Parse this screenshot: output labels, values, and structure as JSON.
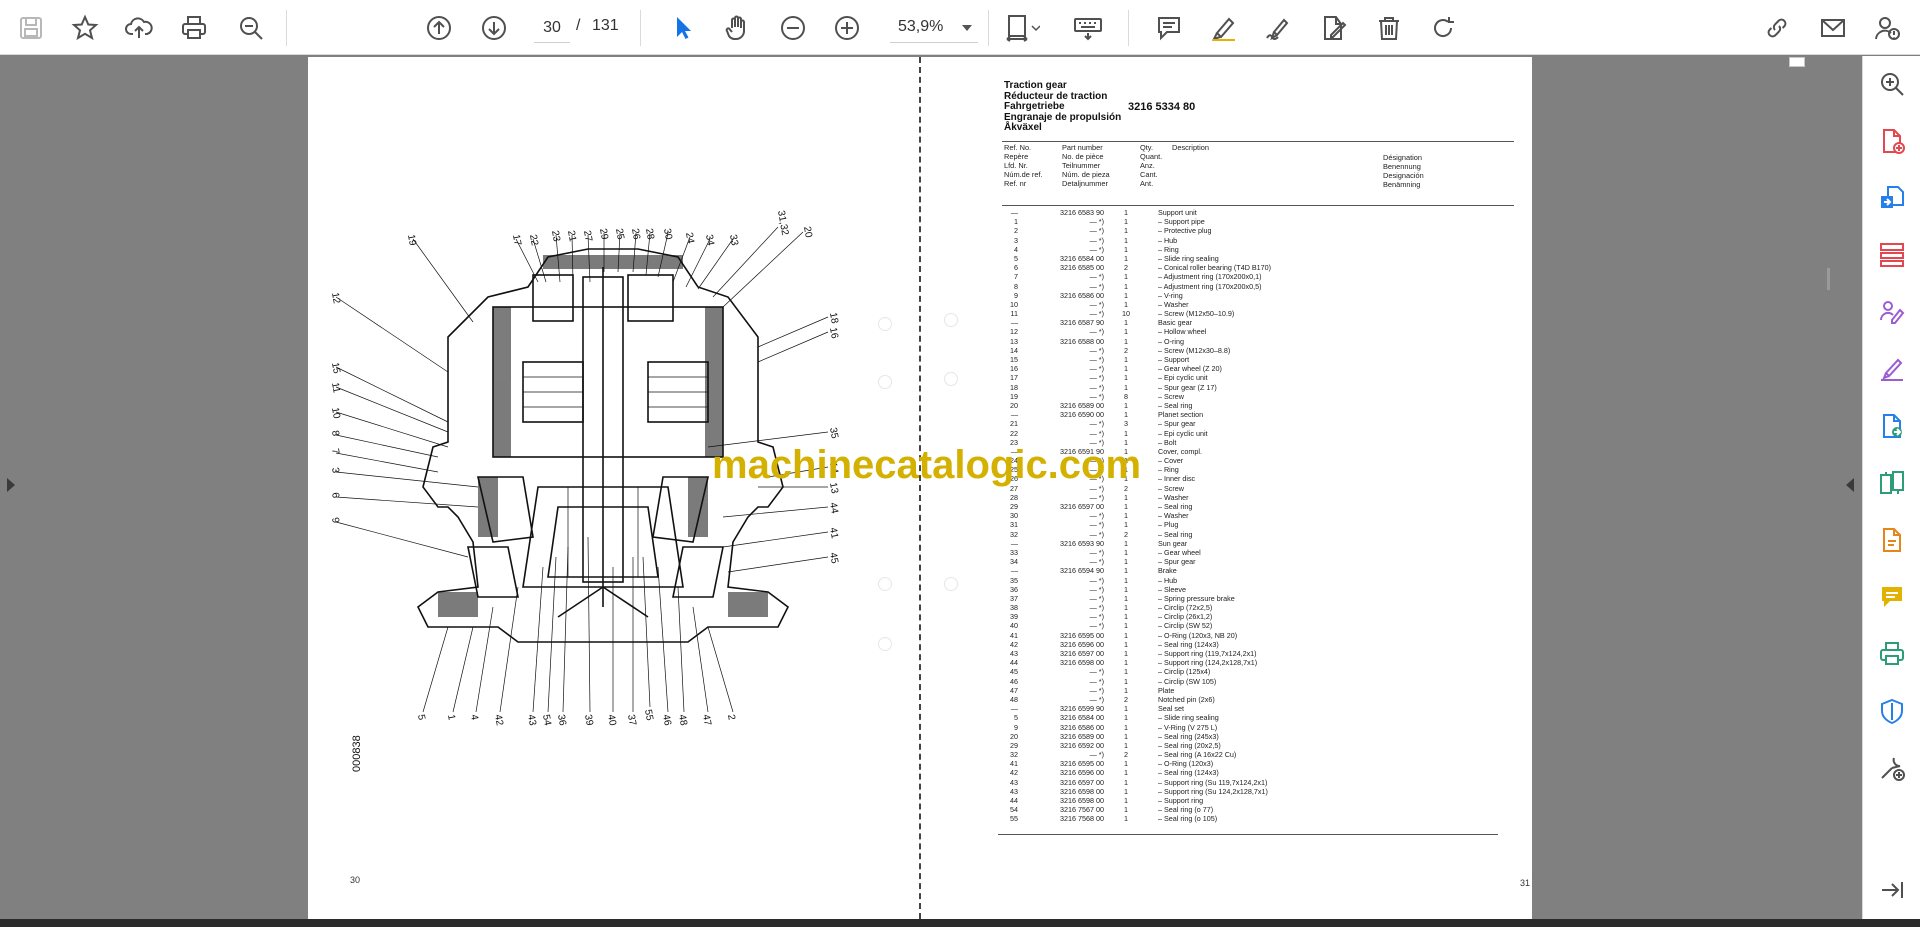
{
  "toolbar": {
    "save_icon": "save-icon",
    "bookmark_icon": "star-icon",
    "upload_icon": "upload-cloud-icon",
    "print_icon": "printer-icon",
    "find_icon": "search-icon",
    "prev_page_icon": "arrow-up-circle-icon",
    "next_page_icon": "arrow-down-circle-icon",
    "current_page": "30",
    "page_separator": "/",
    "total_pages": "131",
    "select_tool_icon": "cursor-arrow-icon",
    "hand_tool_icon": "hand-icon",
    "zoom_out_icon": "minus-circle-icon",
    "zoom_in_icon": "plus-circle-icon",
    "zoom_level": "53,9%",
    "fit_page_icon": "fit-page-icon",
    "keyboard_icon": "keyboard-icon",
    "comment_icon": "comment-icon",
    "highlight_icon": "highlighter-icon",
    "sign_icon": "pen-sign-icon",
    "edit_icon": "edit-document-icon",
    "delete_icon": "trash-icon",
    "rotate_icon": "rotate-icon",
    "share_link_icon": "share-link-icon",
    "email_icon": "envelope-icon",
    "account_icon": "account-icon",
    "accent_color": "#1473e6"
  },
  "rightbar": {
    "items": [
      "zoom-search-icon",
      "create-pdf-icon",
      "export-pdf-icon",
      "organize-pages-icon",
      "request-signature-icon",
      "fill-sign-icon",
      "convert-pdf-icon",
      "compare-icon",
      "edit-pdf-icon",
      "comment-sidebar-icon",
      "print-production-icon",
      "protect-shield-icon",
      "more-tools-icon",
      "expand-panel-icon"
    ],
    "colors": {
      "red": "#e34850",
      "blue": "#2680eb",
      "purple": "#9c5dd4",
      "orange": "#e68619",
      "yellow": "#e1b200",
      "green": "#2d9d78",
      "gray": "#505050"
    }
  },
  "left_page": {
    "page_number": "30",
    "drawing_id": "000838",
    "callouts_top": [
      "19",
      "17",
      "22",
      "23",
      "21",
      "27",
      "29",
      "25",
      "26",
      "28",
      "30",
      "24",
      "34",
      "33",
      "31,32",
      "20"
    ],
    "callouts_left": [
      "12",
      "15",
      "11",
      "10",
      "8",
      "7",
      "3",
      "6",
      "9"
    ],
    "callouts_right": [
      "18",
      "16",
      "35",
      "14",
      "13",
      "44",
      "41",
      "45"
    ],
    "callouts_bottom": [
      "5",
      "1",
      "4",
      "42",
      "43",
      "54",
      "36",
      "39",
      "40",
      "37",
      "55",
      "46",
      "48",
      "47",
      "2"
    ]
  },
  "right_page": {
    "page_number": "31",
    "titles": [
      "Traction gear",
      "Réducteur de traction",
      "Fahrgetriebe",
      "Engranaje de propulsión",
      "Åkväxel"
    ],
    "catalog_number": "3216 5334 80",
    "col_ref": [
      "Ref. No.",
      "Repère",
      "Lfd. Nr.",
      "Núm.de ref.",
      "Ref. nr"
    ],
    "col_part": [
      "Part number",
      "No. de pièce",
      "Teilnummer",
      "Núm. de pieza",
      "Detaljnummer"
    ],
    "col_qty": [
      "Qty.",
      "Quant.",
      "Anz.",
      "Cant.",
      "Ant."
    ],
    "col_desc": [
      "Description"
    ],
    "col_desc_lang": [
      "Désignation",
      "Benennung",
      "Designación",
      "Benämning"
    ],
    "rows": [
      [
        "—",
        "3216 6583 90",
        "1",
        "Support unit"
      ],
      [
        "1",
        "—      *)",
        "1",
        "– Support pipe"
      ],
      [
        "2",
        "—      *)",
        "1",
        "– Protective plug"
      ],
      [
        "3",
        "—      *)",
        "1",
        "– Hub"
      ],
      [
        "4",
        "—      *)",
        "1",
        "– Ring"
      ],
      [
        "5",
        "3216 6584 00",
        "1",
        "– Slide ring sealing"
      ],
      [
        "6",
        "3216 6585 00",
        "2",
        "– Conical roller bearing (T4D B170)"
      ],
      [
        "7",
        "—      *)",
        "1",
        "– Adjustment ring (170x200x0,1)"
      ],
      [
        "8",
        "—      *)",
        "1",
        "– Adjustment ring (170x200x0,5)"
      ],
      [
        "9",
        "3216 6586 00",
        "1",
        "– V-ring"
      ],
      [
        "10",
        "—      *)",
        "1",
        "– Washer"
      ],
      [
        "11",
        "—      *)",
        "10",
        "– Screw (M12x50–10.9)"
      ],
      [
        "—",
        "3216 6587 90",
        "1",
        "Basic gear"
      ],
      [
        "12",
        "—      *)",
        "1",
        "– Hollow wheel"
      ],
      [
        "13",
        "3216 6588 00",
        "1",
        "– O-ring"
      ],
      [
        "14",
        "—      *)",
        "2",
        "– Screw (M12x30–8.8)"
      ],
      [
        "15",
        "—      *)",
        "1",
        "– Support"
      ],
      [
        "16",
        "—      *)",
        "1",
        "– Gear wheel (Z 20)"
      ],
      [
        "17",
        "—      *)",
        "1",
        "– Epi cyclic unit"
      ],
      [
        "18",
        "—      *)",
        "1",
        "– Spur gear (Z 17)"
      ],
      [
        "19",
        "—      *)",
        "8",
        "– Screw"
      ],
      [
        "20",
        "3216 6589 00",
        "1",
        "– Seal ring"
      ],
      [
        "—",
        "3216 6590 00",
        "1",
        "Planet section"
      ],
      [
        "21",
        "—      *)",
        "3",
        "– Spur gear"
      ],
      [
        "22",
        "—      *)",
        "1",
        "– Epi cyclic unit"
      ],
      [
        "23",
        "—      *)",
        "1",
        "– Bolt"
      ],
      [
        "—",
        "3216 6591 90",
        "1",
        "Cover, compl."
      ],
      [
        "24",
        "—      *)",
        "1",
        "– Cover"
      ],
      [
        "25",
        "—      *)",
        "1",
        "– Ring"
      ],
      [
        "26",
        "—      *)",
        "1",
        "– Inner disc"
      ],
      [
        "27",
        "—      *)",
        "2",
        "– Screw"
      ],
      [
        "28",
        "—      *)",
        "1",
        "– Washer"
      ],
      [
        "29",
        "3216 6597 00",
        "1",
        "– Seal ring"
      ],
      [
        "30",
        "—      *)",
        "1",
        "– Washer"
      ],
      [
        "31",
        "—      *)",
        "1",
        "– Plug"
      ],
      [
        "32",
        "—      *)",
        "2",
        "– Seal ring"
      ],
      [
        "—",
        "3216 6593 90",
        "1",
        "Sun gear"
      ],
      [
        "33",
        "—      *)",
        "1",
        "– Gear wheel"
      ],
      [
        "34",
        "—      *)",
        "1",
        "– Spur gear"
      ],
      [
        "—",
        "3216 6594 90",
        "1",
        "Brake"
      ],
      [
        "35",
        "—      *)",
        "1",
        "– Hub"
      ],
      [
        "36",
        "—      *)",
        "1",
        "– Sleeve"
      ],
      [
        "37",
        "—      *)",
        "1",
        "– Spring pressure brake"
      ],
      [
        "38",
        "—      *)",
        "1",
        "– Circlip (72x2,5)"
      ],
      [
        "39",
        "—      *)",
        "1",
        "– Circlip (26x1,2)"
      ],
      [
        "40",
        "—      *)",
        "1",
        "– Circlip (SW 52)"
      ],
      [
        "41",
        "3216 6595 00",
        "1",
        "– O-Ring (120x3, NB 20)"
      ],
      [
        "42",
        "3216 6596 00",
        "1",
        "– Seal ring (124x3)"
      ],
      [
        "43",
        "3216 6597 00",
        "1",
        "– Support ring (119,7x124,2x1)"
      ],
      [
        "44",
        "3216 6598 00",
        "1",
        "– Support ring (124,2x128,7x1)"
      ],
      [
        "45",
        "—      *)",
        "1",
        "– Circlip (125x4)"
      ],
      [
        "46",
        "—      *)",
        "1",
        "– Circlip (SW 105)"
      ],
      [
        "47",
        "—      *)",
        "1",
        "Plate"
      ],
      [
        "48",
        "—      *)",
        "2",
        "Notched pin (2x6)"
      ],
      [
        "—",
        "3216 6599 90",
        "1",
        "Seal set"
      ],
      [
        "5",
        "3216 6584 00",
        "1",
        "– Slide ring sealing"
      ],
      [
        "9",
        "3216 6586 00",
        "1",
        "– V-Ring (V 275 L)"
      ],
      [
        "20",
        "3216 6589 00",
        "1",
        "– Seal ring (245x3)"
      ],
      [
        "29",
        "3216 6592 00",
        "1",
        "– Seal ring (20x2,5)"
      ],
      [
        "32",
        "—      *)",
        "2",
        "– Seal ring (A 16x22 Cu)"
      ],
      [
        "41",
        "3216 6595 00",
        "1",
        "– O-Ring (120x3)"
      ],
      [
        "42",
        "3216 6596 00",
        "1",
        "– Seal ring (124x3)"
      ],
      [
        "43",
        "3216 6597 00",
        "1",
        "– Support ring (Su 119,7x124,2x1)"
      ],
      [
        "43",
        "3216 6598 00",
        "1",
        "– Support ring (Su 124,2x128,7x1)"
      ],
      [
        "44",
        "3216 6598 00",
        "1",
        "– Support ring"
      ],
      [
        "54",
        "3216 7567 00",
        "1",
        "– Seal ring (o 77)"
      ],
      [
        "55",
        "3216 7568 00",
        "1",
        "– Seal ring (o 105)"
      ]
    ]
  },
  "watermark": "machinecatalogic.com"
}
